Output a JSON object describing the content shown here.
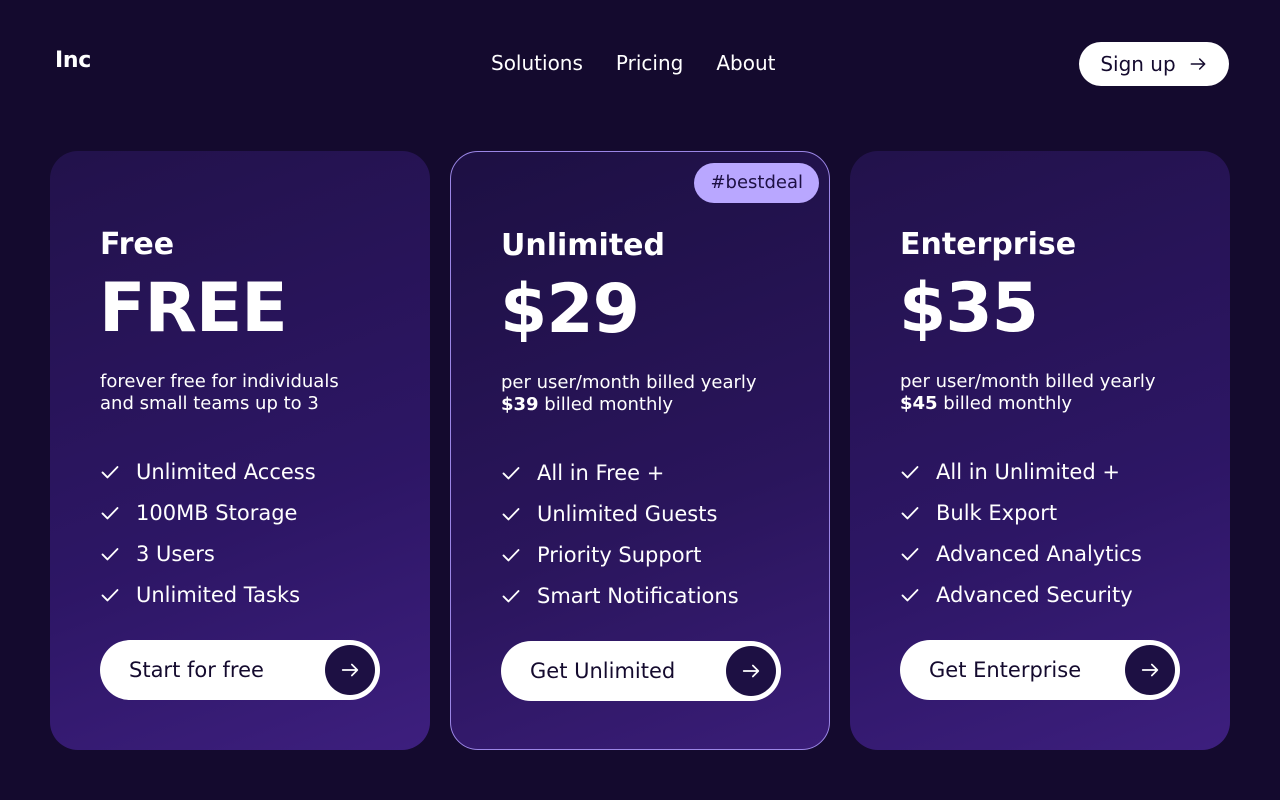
{
  "header": {
    "logo": "Inc",
    "nav": [
      "Solutions",
      "Pricing",
      "About"
    ],
    "signup_label": "Sign up"
  },
  "plans": [
    {
      "name": "Free",
      "price": "FREE",
      "desc_line1": "forever free for individuals",
      "desc_line2_strong": "",
      "desc_line2": "and small teams up to 3",
      "features": [
        "Unlimited Access",
        "100MB Storage",
        "3 Users",
        "Unlimited Tasks"
      ],
      "cta": "Start for free"
    },
    {
      "name": "Unlimited",
      "badge": "#bestdeal",
      "price": "$29",
      "desc_line1": "per user/month billed yearly",
      "desc_line2_strong": "$39",
      "desc_line2": " billed monthly",
      "features": [
        "All in Free +",
        "Unlimited Guests",
        "Priority Support",
        "Smart Notifications"
      ],
      "cta": "Get Unlimited"
    },
    {
      "name": "Enterprise",
      "price": "$35",
      "desc_line1": "per user/month billed yearly",
      "desc_line2_strong": "$45",
      "desc_line2": " billed monthly",
      "features": [
        "All in Unlimited +",
        "Bulk Export",
        "Advanced Analytics",
        "Advanced Security"
      ],
      "cta": "Get Enterprise"
    }
  ],
  "colors": {
    "background": "#140a2e",
    "card_start": "#22124b",
    "card_end": "#3d1f7e",
    "badge_bg": "#b9a7ff",
    "featured_border": "#9b86e6",
    "button_bg": "#ffffff",
    "button_circle": "#1d1043"
  },
  "icons": {
    "feature": "check-icon",
    "cta": "arrow-right-icon"
  }
}
